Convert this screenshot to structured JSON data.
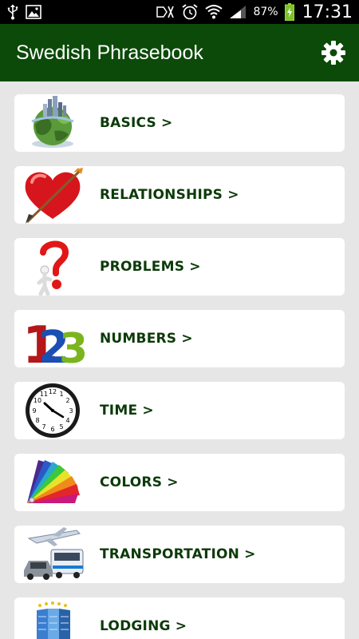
{
  "status_bar": {
    "battery_percent": "87%",
    "time": "17:31"
  },
  "app_bar": {
    "title": "Swedish Phrasebook",
    "settings_icon": "gear-icon"
  },
  "categories": [
    {
      "label": "BASICS >",
      "icon": "globe-icon"
    },
    {
      "label": "RELATIONSHIPS >",
      "icon": "heart-icon"
    },
    {
      "label": "PROBLEMS >",
      "icon": "question-mark-icon"
    },
    {
      "label": "NUMBERS >",
      "icon": "numbers-icon"
    },
    {
      "label": "TIME >",
      "icon": "clock-icon"
    },
    {
      "label": "COLORS >",
      "icon": "color-palette-icon"
    },
    {
      "label": "TRANSPORTATION >",
      "icon": "vehicles-icon"
    },
    {
      "label": "LODGING >",
      "icon": "hotel-icon"
    }
  ],
  "colors": {
    "app_bar": "#0b4a08",
    "label_text": "#0c3a0a",
    "background": "#e6e6e6"
  }
}
